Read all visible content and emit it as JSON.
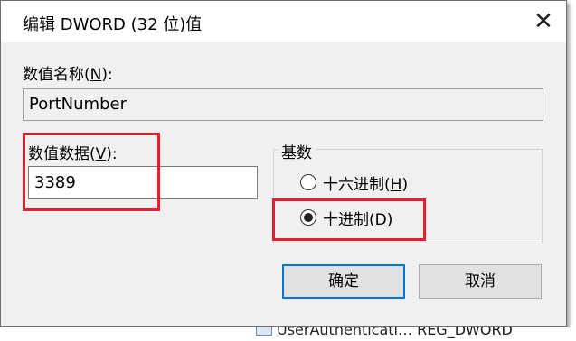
{
  "dialog": {
    "title": "编辑 DWORD (32 位)值",
    "close_glyph": "✕"
  },
  "value_name": {
    "label_prefix": "数值名称(",
    "label_key": "N",
    "label_suffix": "):",
    "value": "PortNumber"
  },
  "value_data": {
    "label_prefix": "数值数据(",
    "label_key": "V",
    "label_suffix": "):",
    "value": "3389"
  },
  "base": {
    "title": "基数",
    "options": [
      {
        "label_prefix": "十六进制(",
        "label_key": "H",
        "label_suffix": ")",
        "selected": false
      },
      {
        "label_prefix": "十进制(",
        "label_key": "D",
        "label_suffix": ")",
        "selected": true
      }
    ]
  },
  "buttons": {
    "ok": "确定",
    "cancel": "取消"
  },
  "background": {
    "partial_text": "UserAuthenticati…  REG_DWORD"
  },
  "colors": {
    "highlight": "#e5202e",
    "focus": "#0078d7"
  }
}
